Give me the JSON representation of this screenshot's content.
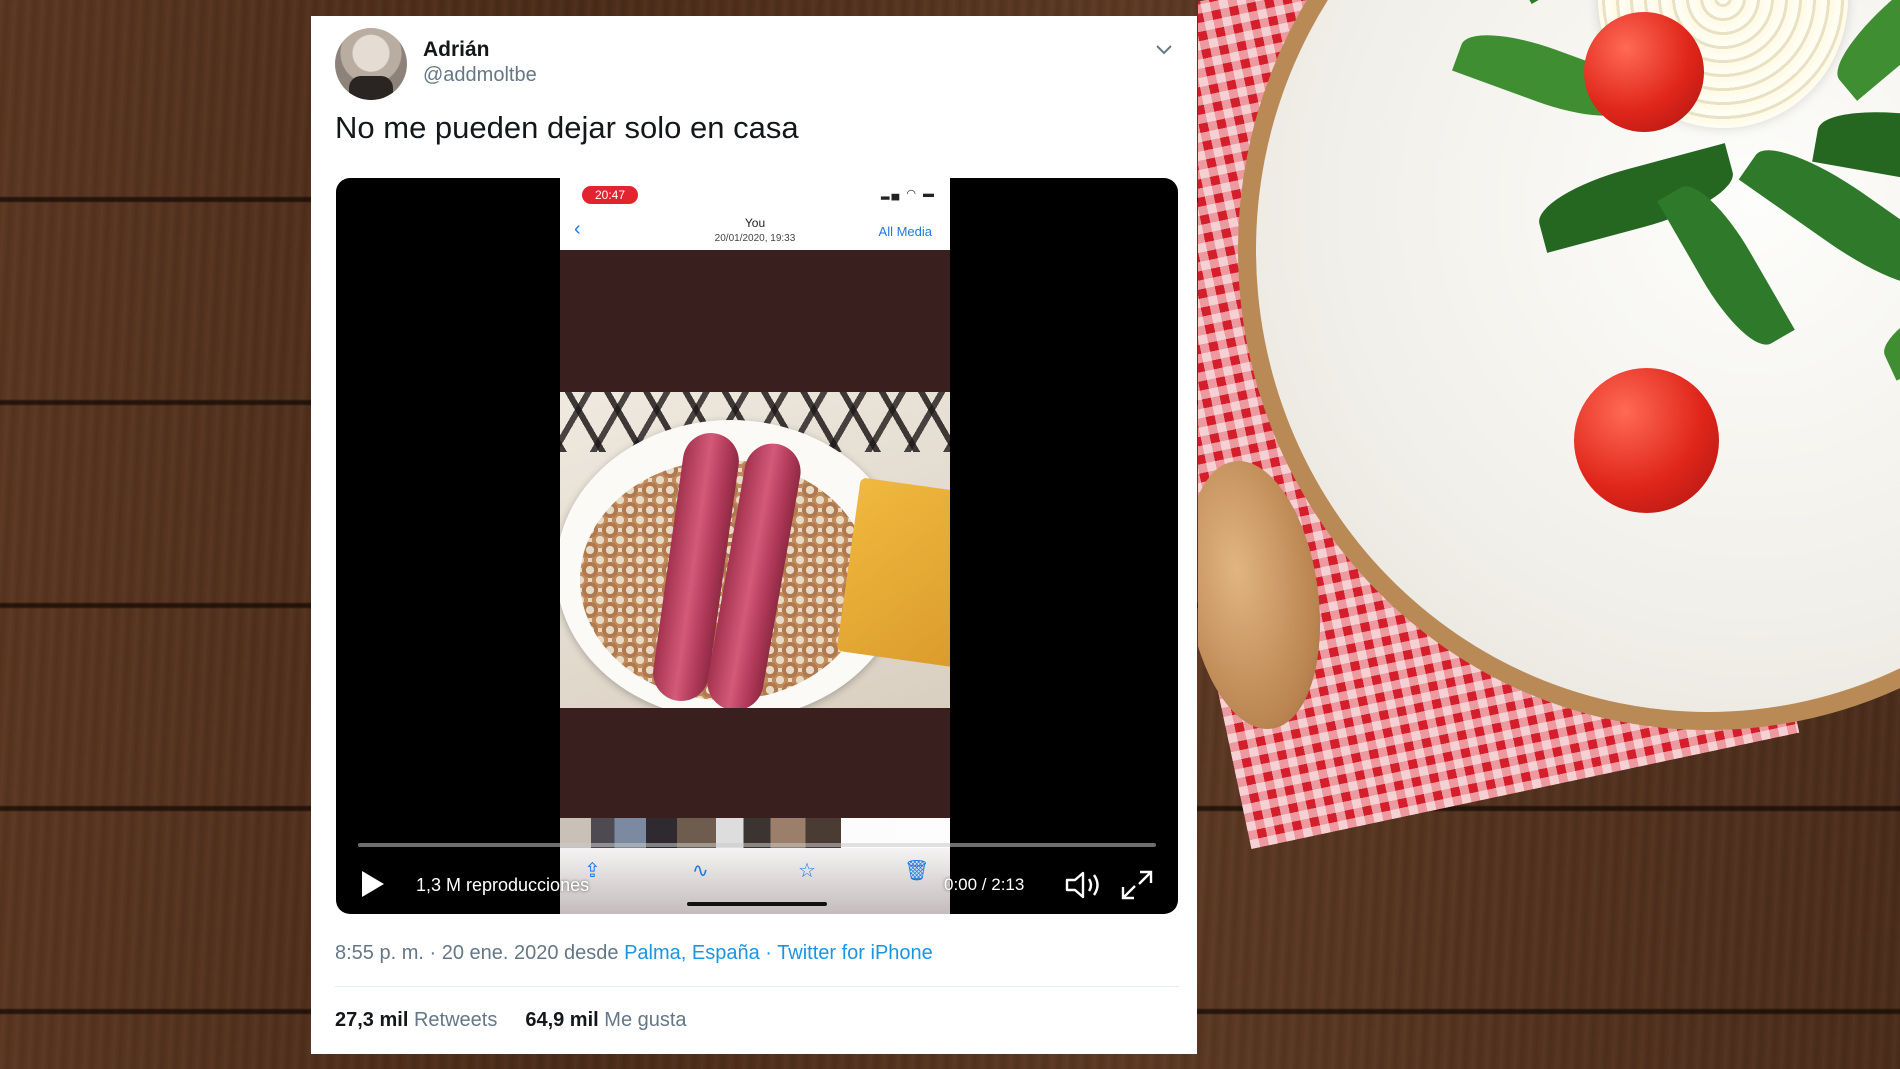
{
  "tweet": {
    "author_name": "Adrián",
    "author_handle": "@addmoltbe",
    "text": "No me pueden dejar solo en casa",
    "video": {
      "views": "1,3 M reproducciones",
      "timecode": "0:00 / 2:13",
      "progress": 0,
      "phone_screen": {
        "status_time": "20:47",
        "nav_title": "You",
        "nav_subtitle": "20/01/2020, 19:33",
        "nav_action": "All Media"
      }
    },
    "meta": {
      "timestamp": "8:55 p. m. · 20 ene. 2020 desde ",
      "location": "Palma, España",
      "separator": " · ",
      "source": "Twitter for iPhone"
    },
    "stats": {
      "retweets_count": "27,3 mil",
      "retweets_label": "Retweets",
      "likes_count": "64,9 mil",
      "likes_label": "Me gusta"
    }
  },
  "colors": {
    "link": "#1b95e0",
    "text_primary": "#14171a",
    "text_secondary": "#657786",
    "recording_pill": "#e3232d"
  },
  "icons": [
    "caret-down-icon",
    "play-icon",
    "volume-icon",
    "fullscreen-icon",
    "back-arrow-icon",
    "share-icon",
    "markup-icon",
    "star-icon",
    "trash-icon"
  ]
}
